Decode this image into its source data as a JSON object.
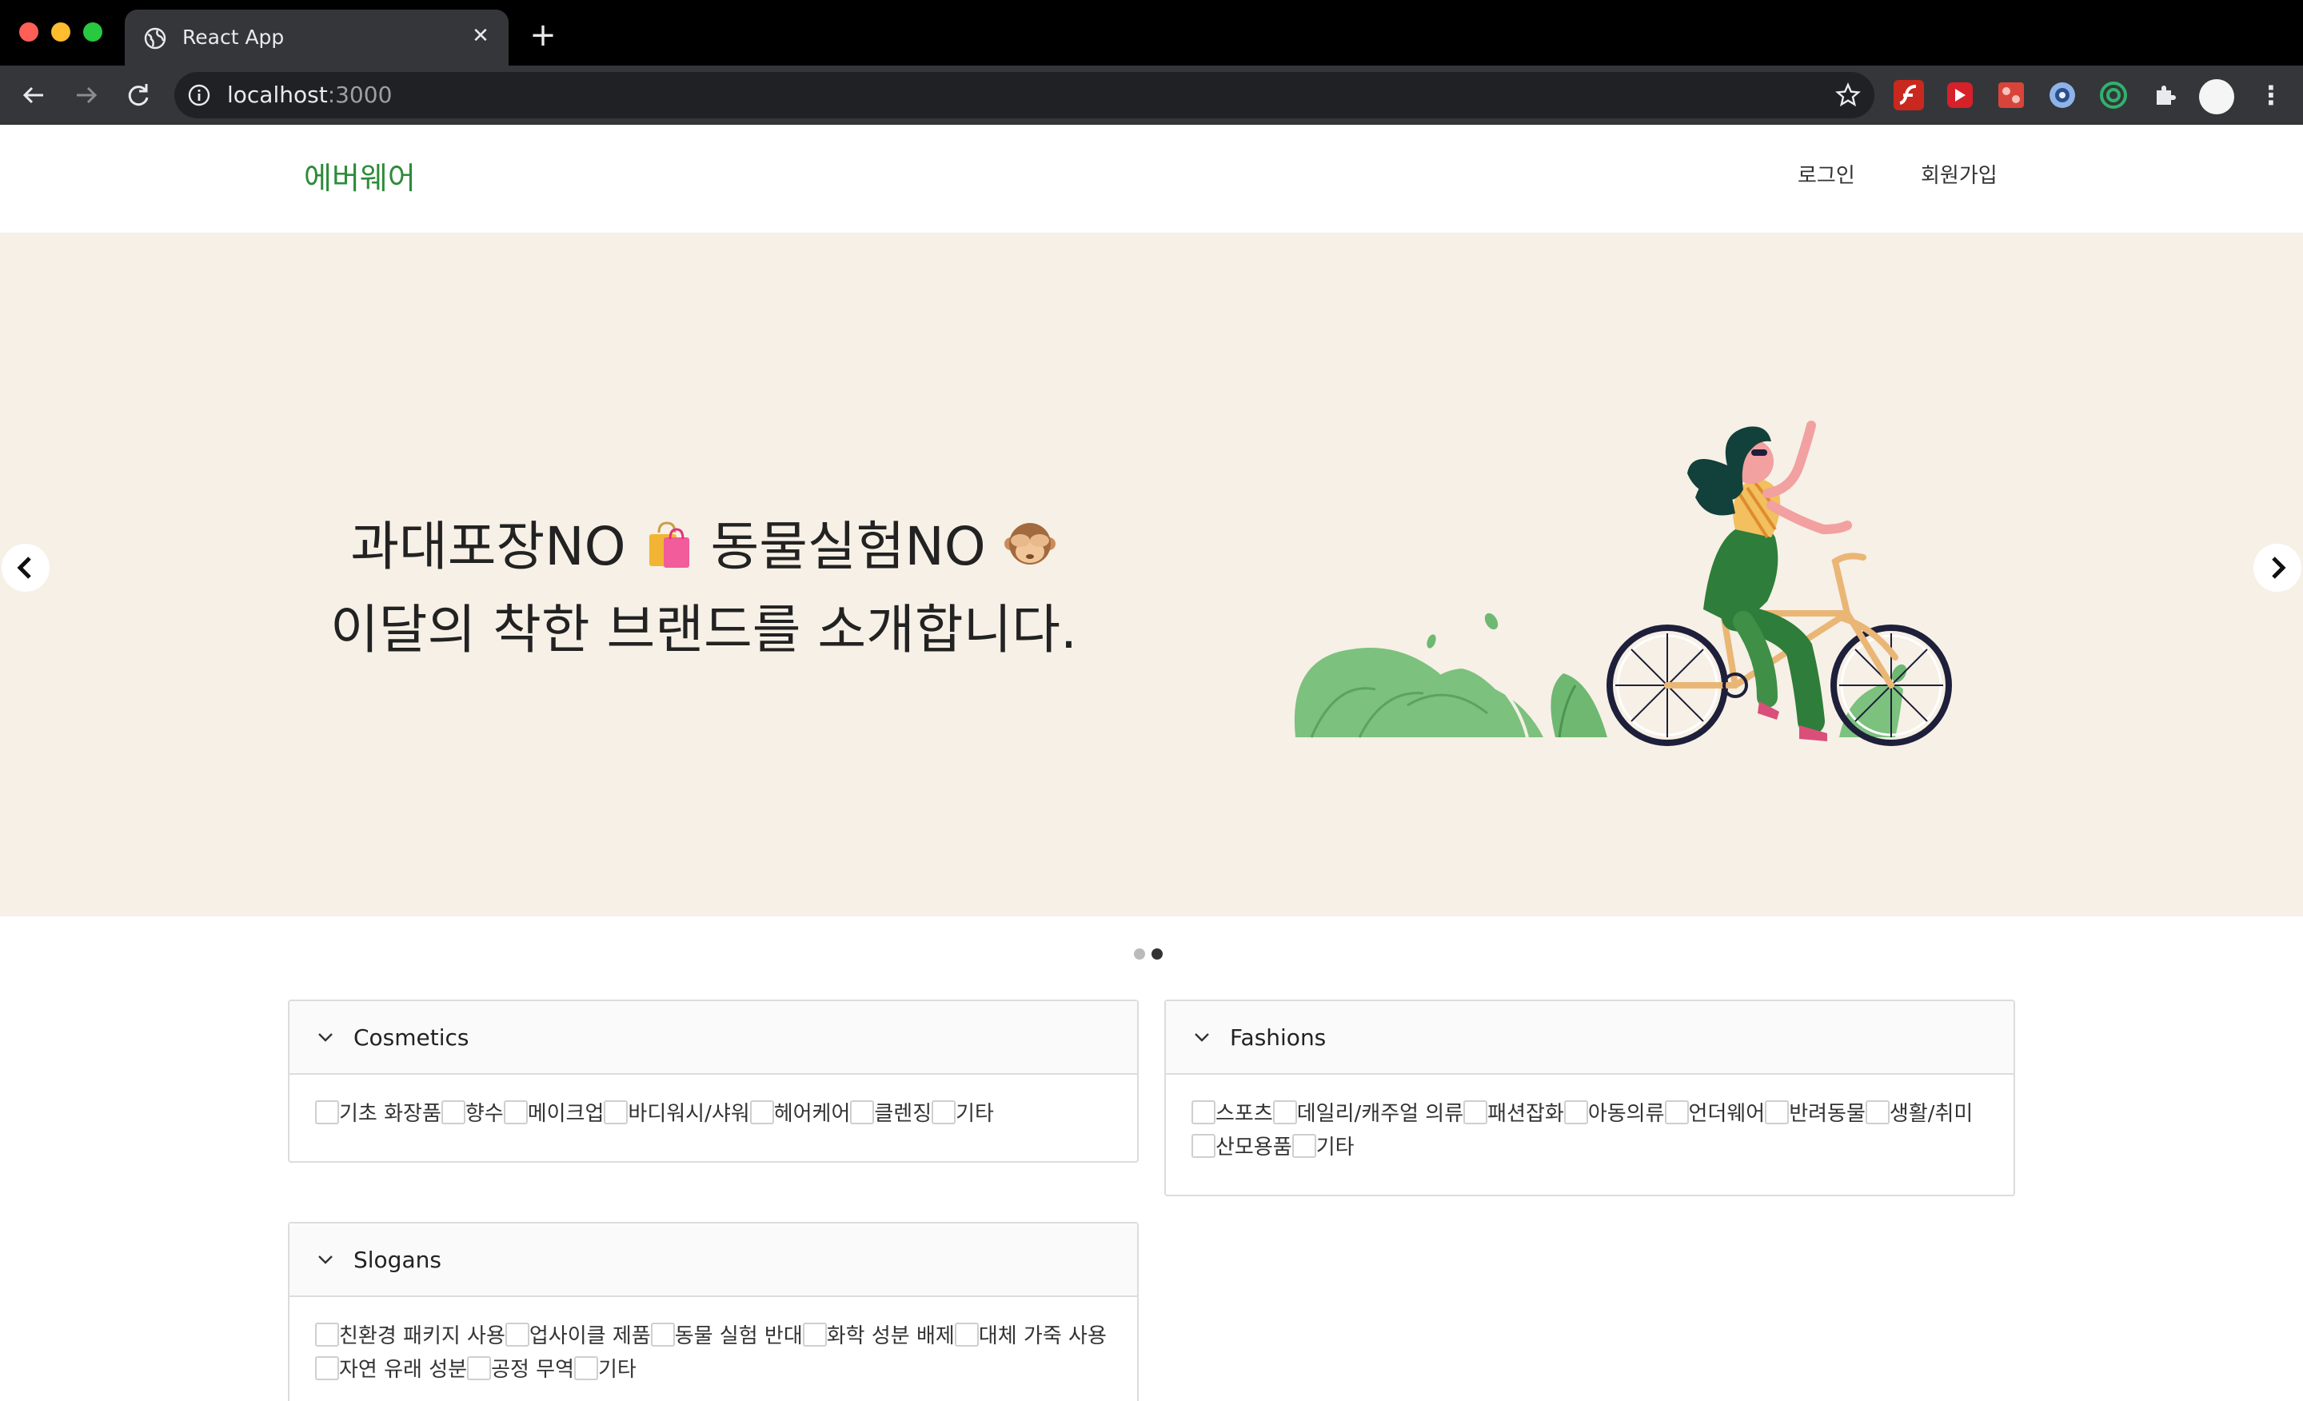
{
  "browser": {
    "tab_title": "React App",
    "url_host": "localhost",
    "url_port": ":3000"
  },
  "header": {
    "logo": "에버웨어",
    "login": "로그인",
    "signup": "회원가입"
  },
  "carousel": {
    "line1_a": "과대포장NO",
    "line1_b": "동물실험NO",
    "line2": "이달의 착한 브랜드를 소개합니다.",
    "emoji_1": "shopping-bags-icon",
    "emoji_2": "see-no-evil-monkey-icon",
    "slide_count": 2,
    "active_slide": 2
  },
  "categories": {
    "cosmetics": {
      "title": "Cosmetics",
      "options": [
        "기초 화장품",
        "향수",
        "메이크업",
        "바디워시/샤워",
        "헤어케어",
        "클렌징",
        "기타"
      ]
    },
    "fashions": {
      "title": "Fashions",
      "options": [
        "스포츠",
        "데일리/캐주얼 의류",
        "패션잡화",
        "아동의류",
        "언더웨어",
        "반려동물",
        "생활/취미",
        "산모용품",
        "기타"
      ]
    },
    "slogans": {
      "title": "Slogans",
      "options": [
        "친환경 패키지 사용",
        "업사이클 제품",
        "동물 실험 반대",
        "화학 성분 배제",
        "대체 가죽 사용",
        "자연 유래 성분",
        "공정 무역",
        "기타"
      ]
    }
  },
  "colors": {
    "logo": "#2e8b3a",
    "carousel_bg": "#f6f0e6",
    "browser_bg": "#35363a"
  }
}
